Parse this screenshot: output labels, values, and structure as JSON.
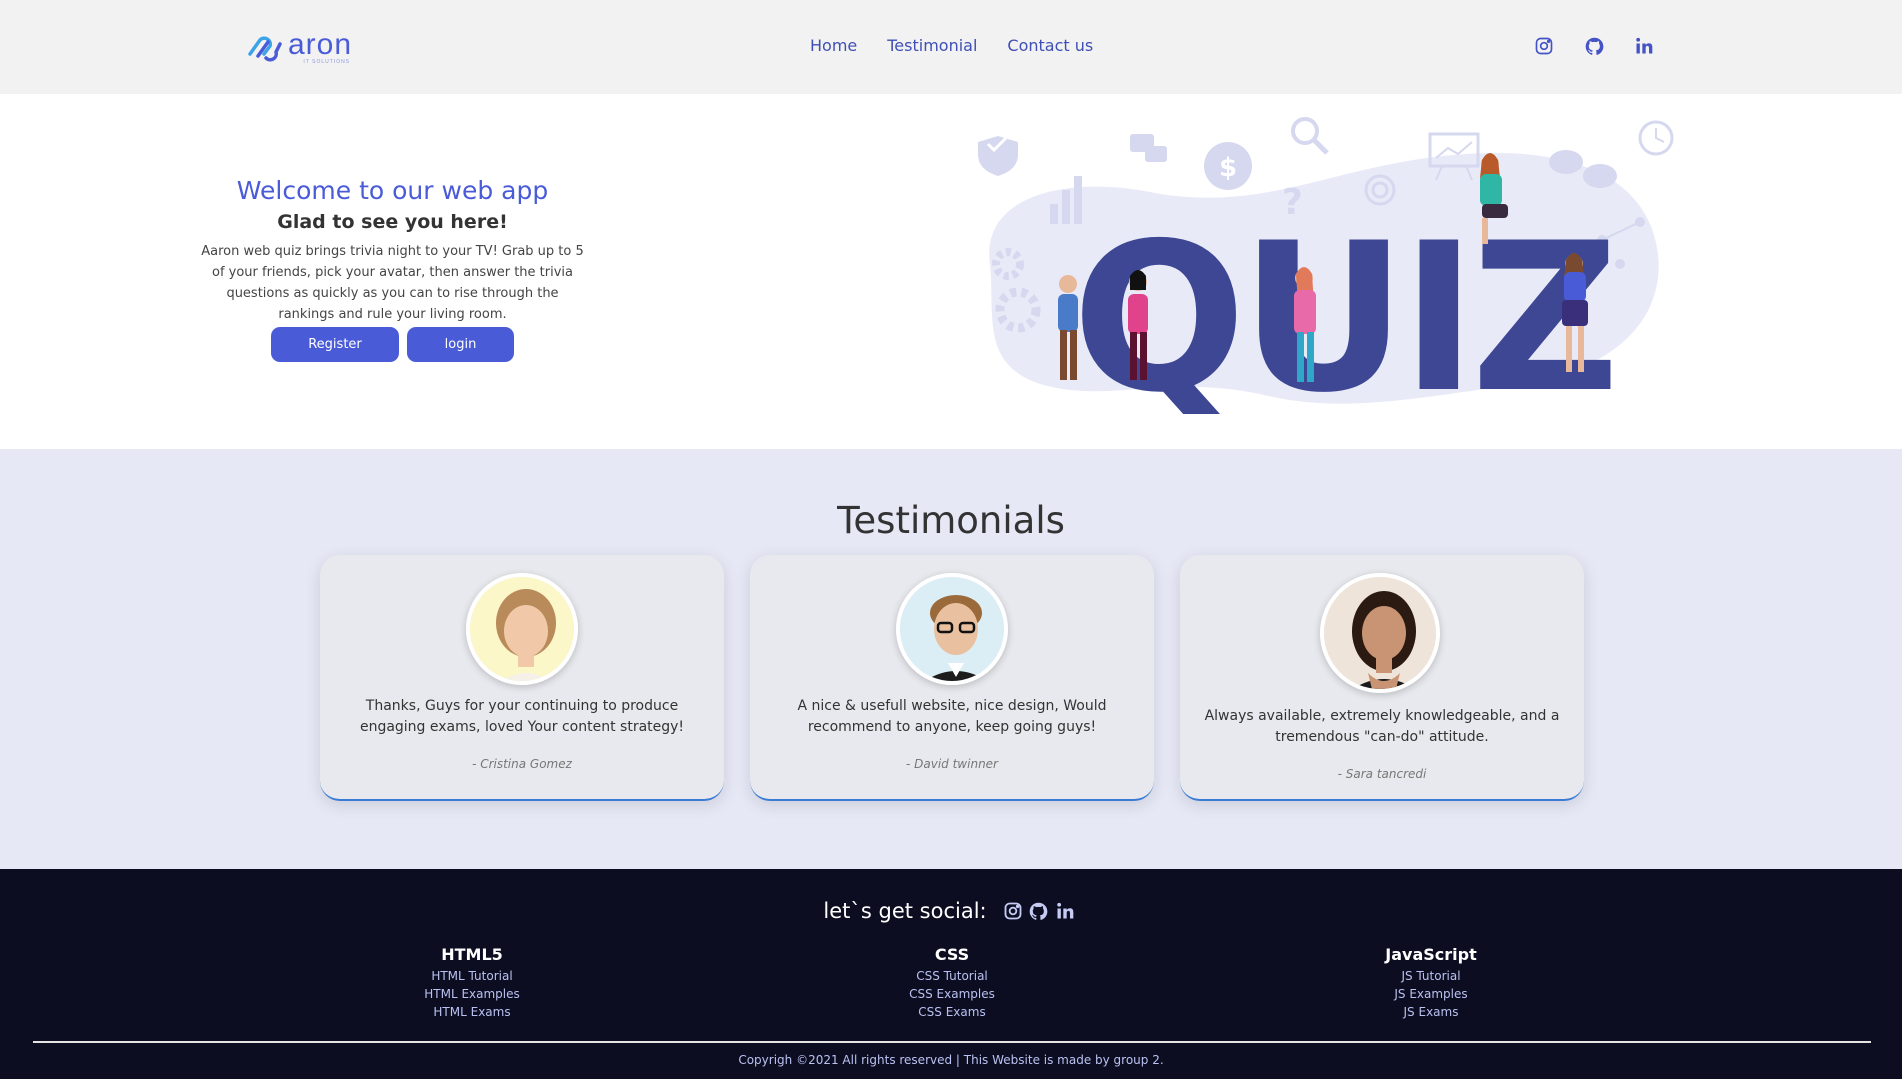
{
  "header": {
    "logo": {
      "word": "aron",
      "sub": "IT SOLUTIONS"
    },
    "nav": [
      {
        "label": "Home"
      },
      {
        "label": "Testimonial"
      },
      {
        "label": "Contact us"
      }
    ],
    "social_icons": [
      "instagram-icon",
      "github-icon",
      "linkedin-icon"
    ]
  },
  "hero": {
    "title": "Welcome to our web app",
    "subtitle": "Glad to see you here!",
    "description": "Aaron web quiz brings trivia night to your TV! Grab up to 5 of your friends, pick your avatar, then answer the trivia questions as quickly as you can to rise through the rankings and rule your living room.",
    "register_label": "Register",
    "login_label": "login",
    "illustration_word": "QUIZ"
  },
  "testimonials": {
    "title": "Testimonials",
    "items": [
      {
        "quote": "Thanks, Guys for your continuing to produce engaging exams, loved Your content strategy!",
        "author": "- Cristina Gomez"
      },
      {
        "quote": "A nice & usefull website, nice design, Would recommend to anyone, keep going guys!",
        "author": "- David twinner"
      },
      {
        "quote": "Always available, extremely knowledgeable, and a tremendous \"can-do\" attitude.",
        "author": "- Sara tancredi"
      }
    ]
  },
  "footer": {
    "social_label": "let`s get social:",
    "columns": [
      {
        "title": "HTML5",
        "links": [
          "HTML Tutorial",
          "HTML Examples",
          "HTML Exams"
        ]
      },
      {
        "title": "CSS",
        "links": [
          "CSS Tutorial",
          "CSS Examples",
          "CSS Exams"
        ]
      },
      {
        "title": "JavaScript",
        "links": [
          "JS Tutorial",
          "JS Examples",
          "JS Exams"
        ]
      }
    ],
    "copyright": "Copyrigh ©2021 All rights reserved | This Website is made by group 2."
  },
  "colors": {
    "accent": "#4a5bd8",
    "header_bg": "#f2f2f2",
    "testimonial_bg": "#e6e8f6",
    "footer_bg": "#0d0d22",
    "quiz_letters": "#3d4794"
  }
}
